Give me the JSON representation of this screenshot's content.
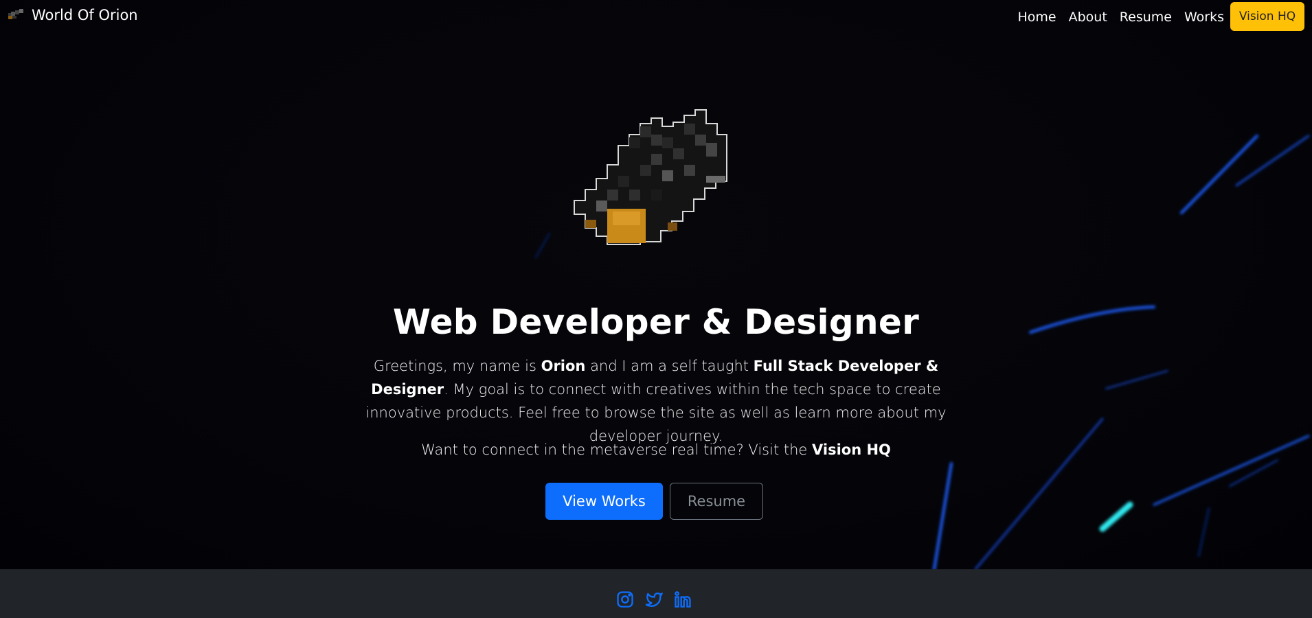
{
  "navbar": {
    "brand_text": "World Of Orion",
    "logo_icon": "orion-pixel-logo-icon",
    "links": [
      "Home",
      "About",
      "Resume",
      "Works"
    ],
    "cta_label": "Vision HQ",
    "cta_color": "#ffc107"
  },
  "hero": {
    "avatar_icon": "pixel-feather-avatar-icon",
    "headline": "Web Developer & Designer",
    "intro": {
      "p1": "Greetings, my name is ",
      "name": "Orion",
      "p2": " and I am a self taught ",
      "role": "Full Stack Developer & Designer",
      "p3": ". My goal is to connect with creatives within the tech space to create innovative products. Feel free to browse the site as well as learn more about my developer journey."
    },
    "cta_line": {
      "text": "Want to connect in the metaverse real time? Visit the ",
      "link": "Vision HQ"
    },
    "buttons": {
      "primary": "View Works",
      "secondary": "Resume"
    },
    "colors": {
      "primary_button": "#0d6efd",
      "streak_blue": "#1f5fff",
      "streak_cyan": "#2ee8ee"
    }
  },
  "footer": {
    "background": "#212529",
    "social_icons": [
      "instagram-icon",
      "twitter-icon",
      "linkedin-icon"
    ],
    "icon_color": "#0d6efd"
  }
}
